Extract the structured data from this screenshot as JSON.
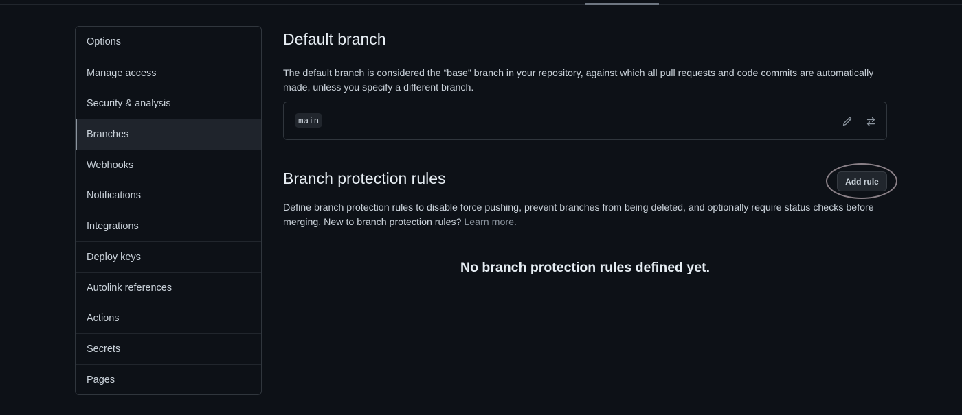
{
  "sidebar": {
    "items": [
      {
        "label": "Options"
      },
      {
        "label": "Manage access"
      },
      {
        "label": "Security & analysis"
      },
      {
        "label": "Branches",
        "selected": true
      },
      {
        "label": "Webhooks"
      },
      {
        "label": "Notifications"
      },
      {
        "label": "Integrations"
      },
      {
        "label": "Deploy keys"
      },
      {
        "label": "Autolink references"
      },
      {
        "label": "Actions"
      },
      {
        "label": "Secrets"
      },
      {
        "label": "Pages"
      }
    ]
  },
  "default_branch": {
    "title": "Default branch",
    "description": "The default branch is considered the “base” branch in your repository, against which all pull requests and code commits are automatically made, unless you specify a different branch.",
    "branch_name": "main",
    "edit_icon": "pencil-icon",
    "switch_icon": "arrow-switch-icon"
  },
  "protection_rules": {
    "title": "Branch protection rules",
    "add_rule_label": "Add rule",
    "description": "Define branch protection rules to disable force pushing, prevent branches from being deleted, and optionally require status checks before merging. New to branch protection rules?",
    "learn_more": "Learn more.",
    "empty_state": "No branch protection rules defined yet."
  },
  "colors": {
    "background": "#0d1117",
    "border": "#30363d",
    "text": "#c9d1d9",
    "highlight_ring": "#8a8087"
  }
}
